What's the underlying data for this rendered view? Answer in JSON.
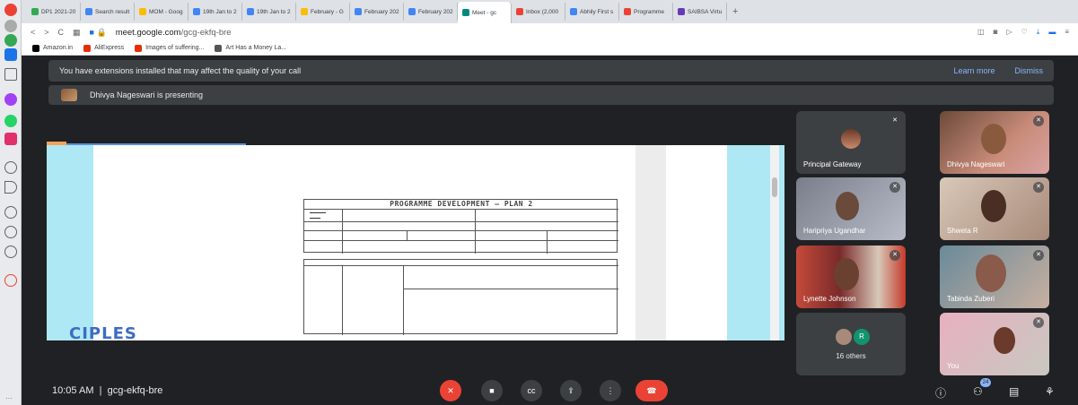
{
  "browser": {
    "tabs": [
      {
        "label": "DP1 2021-20",
        "color": "#34a853"
      },
      {
        "label": "Search result",
        "color": "#4285f4"
      },
      {
        "label": "MOM - Goog",
        "color": "#fbbc04"
      },
      {
        "label": "19th Jan to 2",
        "color": "#4285f4"
      },
      {
        "label": "19th Jan to 2",
        "color": "#4285f4"
      },
      {
        "label": "February - G",
        "color": "#fbbc04"
      },
      {
        "label": "February 202",
        "color": "#4285f4"
      },
      {
        "label": "February 202",
        "color": "#4285f4"
      },
      {
        "label": "Meet - gc",
        "color": "#00897b",
        "active": true
      },
      {
        "label": "Inbox (2,000",
        "color": "#ea4335"
      },
      {
        "label": "Abhily First s",
        "color": "#4285f4"
      },
      {
        "label": "Programme",
        "color": "#ea4335"
      },
      {
        "label": "SAIBSA Virtu",
        "color": "#673ab7"
      }
    ],
    "new_tab": "+",
    "url_host": "meet.google.com",
    "url_path": "/gcg-ekfq-bre",
    "bookmarks": [
      {
        "label": "Amazon.in",
        "color": "#000000"
      },
      {
        "label": "AliExpress",
        "color": "#e62e04"
      },
      {
        "label": "Images of suffering...",
        "color": "#e62e04"
      },
      {
        "label": "Art Has a Money La...",
        "color": "#555555"
      }
    ]
  },
  "meet": {
    "banner_text": "You have extensions installed that may affect the quality of your call",
    "learn_more": "Learn more",
    "dismiss": "Dismiss",
    "presenting_text": "Dhivya Nageswari is presenting",
    "doc_title": "PROGRAMME DEVELOPMENT — PLAN 2",
    "doc_fragment": "CIPLES",
    "participants": [
      {
        "name": "Principal Gateway"
      },
      {
        "name": "Dhivya Nageswari"
      },
      {
        "name": "Haripriya Ugandhar"
      },
      {
        "name": "Shweta R"
      },
      {
        "name": "Lynette Johnson"
      },
      {
        "name": "Tabinda Zuberi"
      },
      {
        "name": "You"
      }
    ],
    "others_chip": "R",
    "others_count": "16 others",
    "time": "10:05 AM",
    "separator": "|",
    "meeting_code": "gcg-ekfq-bre",
    "people_badge": "24"
  },
  "colors": {
    "accent": "#8ab4f8",
    "end_call": "#ea4335",
    "background": "#202124"
  }
}
